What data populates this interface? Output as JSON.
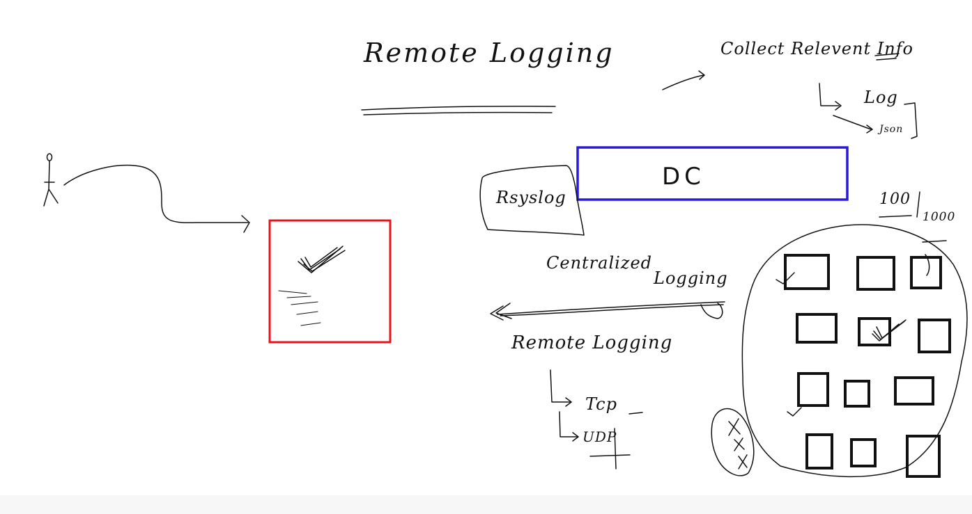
{
  "title": "Remote Logging",
  "collect_text": "Collect Relevent Info",
  "log_label": "Log",
  "json_label": "Json",
  "dc_label": "DC",
  "rsyslog_label": "Rsyslog",
  "count_top": "100",
  "count_bottom": "1000",
  "centralized_label": "Centralized",
  "logging_label": "Logging",
  "remote_logging_label": "Remote Logging",
  "tcp_label": "Tcp",
  "udp_label": "UDP",
  "colors": {
    "background": "#ffffff",
    "ink": "#111111",
    "highlight_box": "#e8141b",
    "dc_box": "#2a19d8"
  }
}
